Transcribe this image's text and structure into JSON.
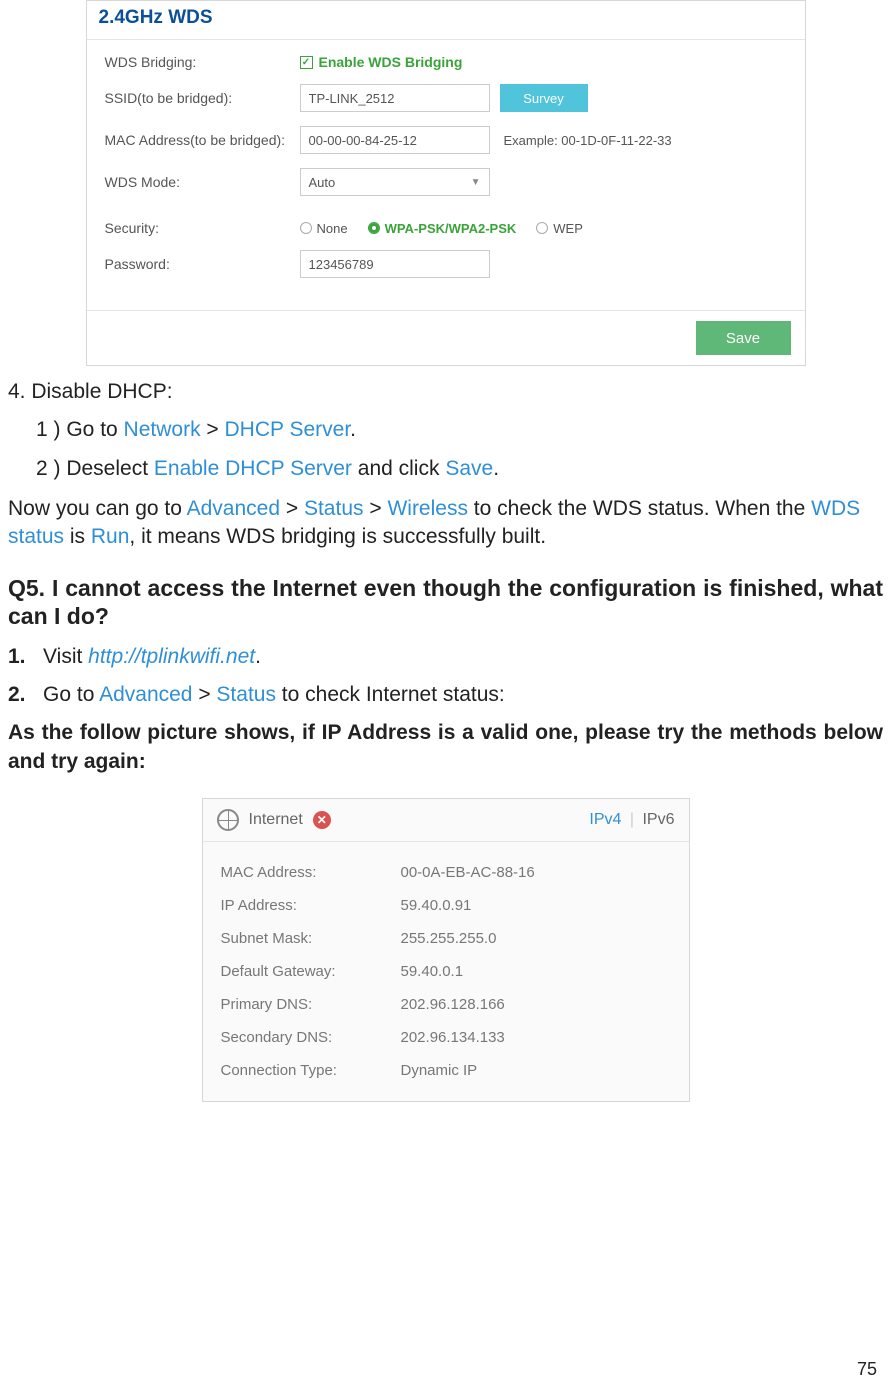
{
  "wds_panel": {
    "title": "2.4GHz WDS",
    "labels": {
      "bridging": "WDS Bridging:",
      "ssid": "SSID(to be bridged):",
      "mac": "MAC Address(to be bridged):",
      "mode": "WDS Mode:",
      "security": "Security:",
      "password": "Password:"
    },
    "enable_label": "Enable WDS Bridging",
    "ssid_value": "TP-LINK_2512",
    "survey_label": "Survey",
    "mac_value": "00-00-00-84-25-12",
    "example_label": "Example: 00-1D-0F-11-22-33",
    "mode_value": "Auto",
    "security_options": {
      "none": "None",
      "wpa": "WPA-PSK/WPA2-PSK",
      "wep": "WEP"
    },
    "password_value": "123456789",
    "save_label": "Save"
  },
  "text": {
    "step4_title": "4. Disable DHCP:",
    "step4_1_prefix": "1 )   Go to ",
    "step4_1_link1": "Network",
    "step4_1_sep": " > ",
    "step4_1_link2": "DHCP Server",
    "step4_1_suffix": ".",
    "step4_2_prefix": "2 )   Deselect ",
    "step4_2_link1": "Enable DHCP Server",
    "step4_2_mid": " and click ",
    "step4_2_link2": "Save",
    "step4_2_suffix": ".",
    "now_prefix": "Now you can go to ",
    "now_link1": "Advanced",
    "now_sep1": " > ",
    "now_link2": "Status",
    "now_sep2": " > ",
    "now_link3": "Wireless",
    "now_mid": " to check the WDS status. When the ",
    "now_link4": "WDS status",
    "now_mid2": " is ",
    "now_link5": "Run",
    "now_suffix": ", it means WDS bridging is successfully built.",
    "q5_label": "Q5. ",
    "q5_body": "I cannot access the Internet even though the configuration is finished, what can I do?",
    "step1_num": "1.",
    "step1_prefix": "Visit ",
    "step1_link": "http://tplinkwifi.net",
    "step1_suffix": ".",
    "step2_num": "2.",
    "step2_prefix": "Go to ",
    "step2_link1": "Advanced",
    "step2_sep": " > ",
    "step2_link2": "Status",
    "step2_suffix": " to check Internet status:",
    "follow_text": "As the follow picture shows, if IP Address is a valid one, please try the methods below and try again:"
  },
  "internet_panel": {
    "title": "Internet",
    "ipv4": "IPv4",
    "ipv6": "IPv6",
    "rows": {
      "mac_l": "MAC Address:",
      "mac_v": "00-0A-EB-AC-88-16",
      "ip_l": "IP Address:",
      "ip_v": "59.40.0.91",
      "mask_l": "Subnet Mask:",
      "mask_v": "255.255.255.0",
      "gw_l": "Default Gateway:",
      "gw_v": "59.40.0.1",
      "pdns_l": "Primary DNS:",
      "pdns_v": "202.96.128.166",
      "sdns_l": "Secondary DNS:",
      "sdns_v": "202.96.134.133",
      "ct_l": "Connection Type:",
      "ct_v": "Dynamic IP"
    }
  },
  "page_number": "75"
}
